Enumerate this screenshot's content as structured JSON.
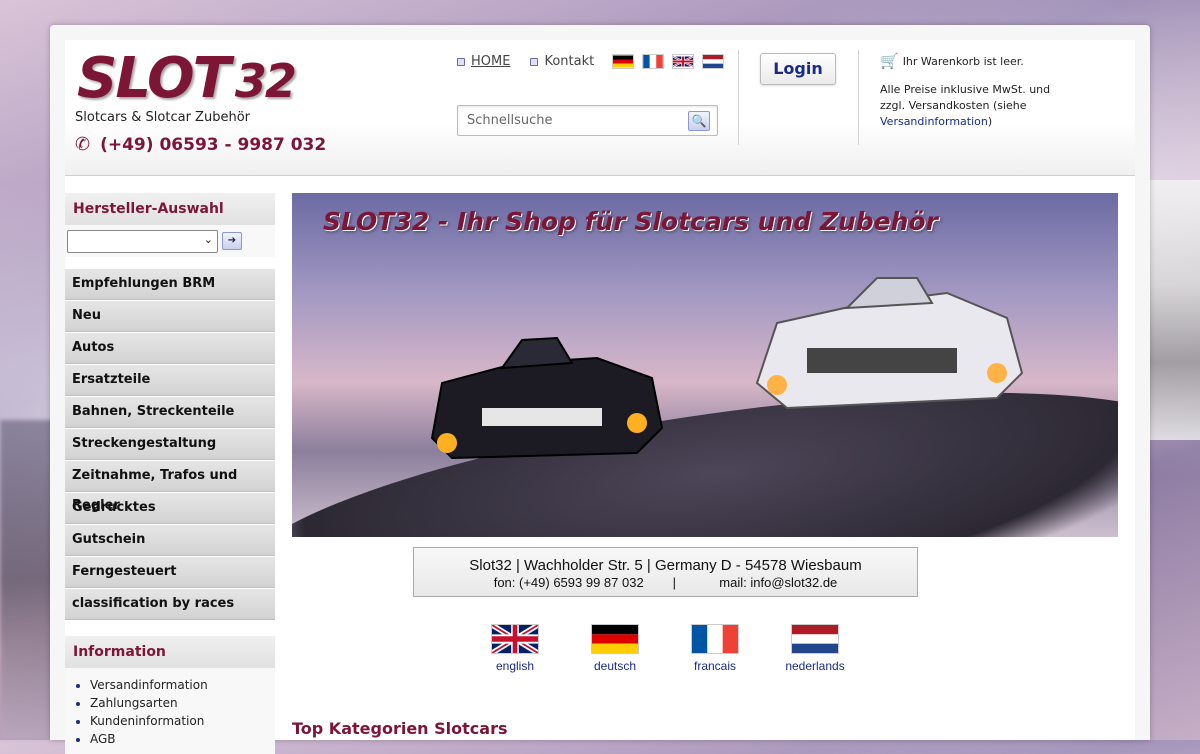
{
  "brand": {
    "logo_main": "SLOT",
    "logo_num": "32",
    "tagline": "Slotcars & Slotcar Zubehör",
    "phone": "(+49) 06593 - 9987 032",
    "color": "#7d1636"
  },
  "topnav": {
    "home": "HOME",
    "contact": "Kontakt"
  },
  "flags": [
    "de",
    "fr",
    "gb",
    "nl"
  ],
  "search": {
    "placeholder": "Schnellsuche"
  },
  "login": {
    "label": "Login"
  },
  "cart": {
    "status": "Ihr Warenkorb ist leer.",
    "price_line1": "Alle Preise inklusive MwSt. und",
    "price_line2_prefix": "zzgl. Versandkosten (siehe ",
    "price_line2_link": "Versandinformation",
    "price_line2_suffix": ")"
  },
  "sidebar": {
    "manufacturer_title": "Hersteller-Auswahl",
    "manufacturer_selected": "",
    "categories": [
      "Empfehlungen BRM",
      "Neu",
      "Autos",
      "Ersatzteile",
      "Bahnen, Streckenteile",
      "Streckengestaltung",
      "Zeitnahme, Trafos und Regler",
      "Gedrucktes",
      "Gutschein",
      "Ferngesteuert",
      "classification by races"
    ],
    "info_title": "Information",
    "info_links": [
      "Versandinformation",
      "Zahlungsarten",
      "Kundeninformation",
      "AGB"
    ]
  },
  "banner": {
    "title": "SLOT32 - Ihr Shop für Slotcars und Zubehör"
  },
  "address": {
    "line1": "Slot32 | Wachholder Str. 5 | Germany D - 54578 Wiesbaum",
    "line2": "fon: (+49) 6593 99 87 032        |            mail: info@slot32.de"
  },
  "languages": [
    {
      "code": "gb",
      "label": "english"
    },
    {
      "code": "de",
      "label": "deutsch"
    },
    {
      "code": "fr",
      "label": "francais"
    },
    {
      "code": "nl",
      "label": "nederlands"
    }
  ],
  "main": {
    "section_title": "Top Kategorien Slotcars"
  }
}
